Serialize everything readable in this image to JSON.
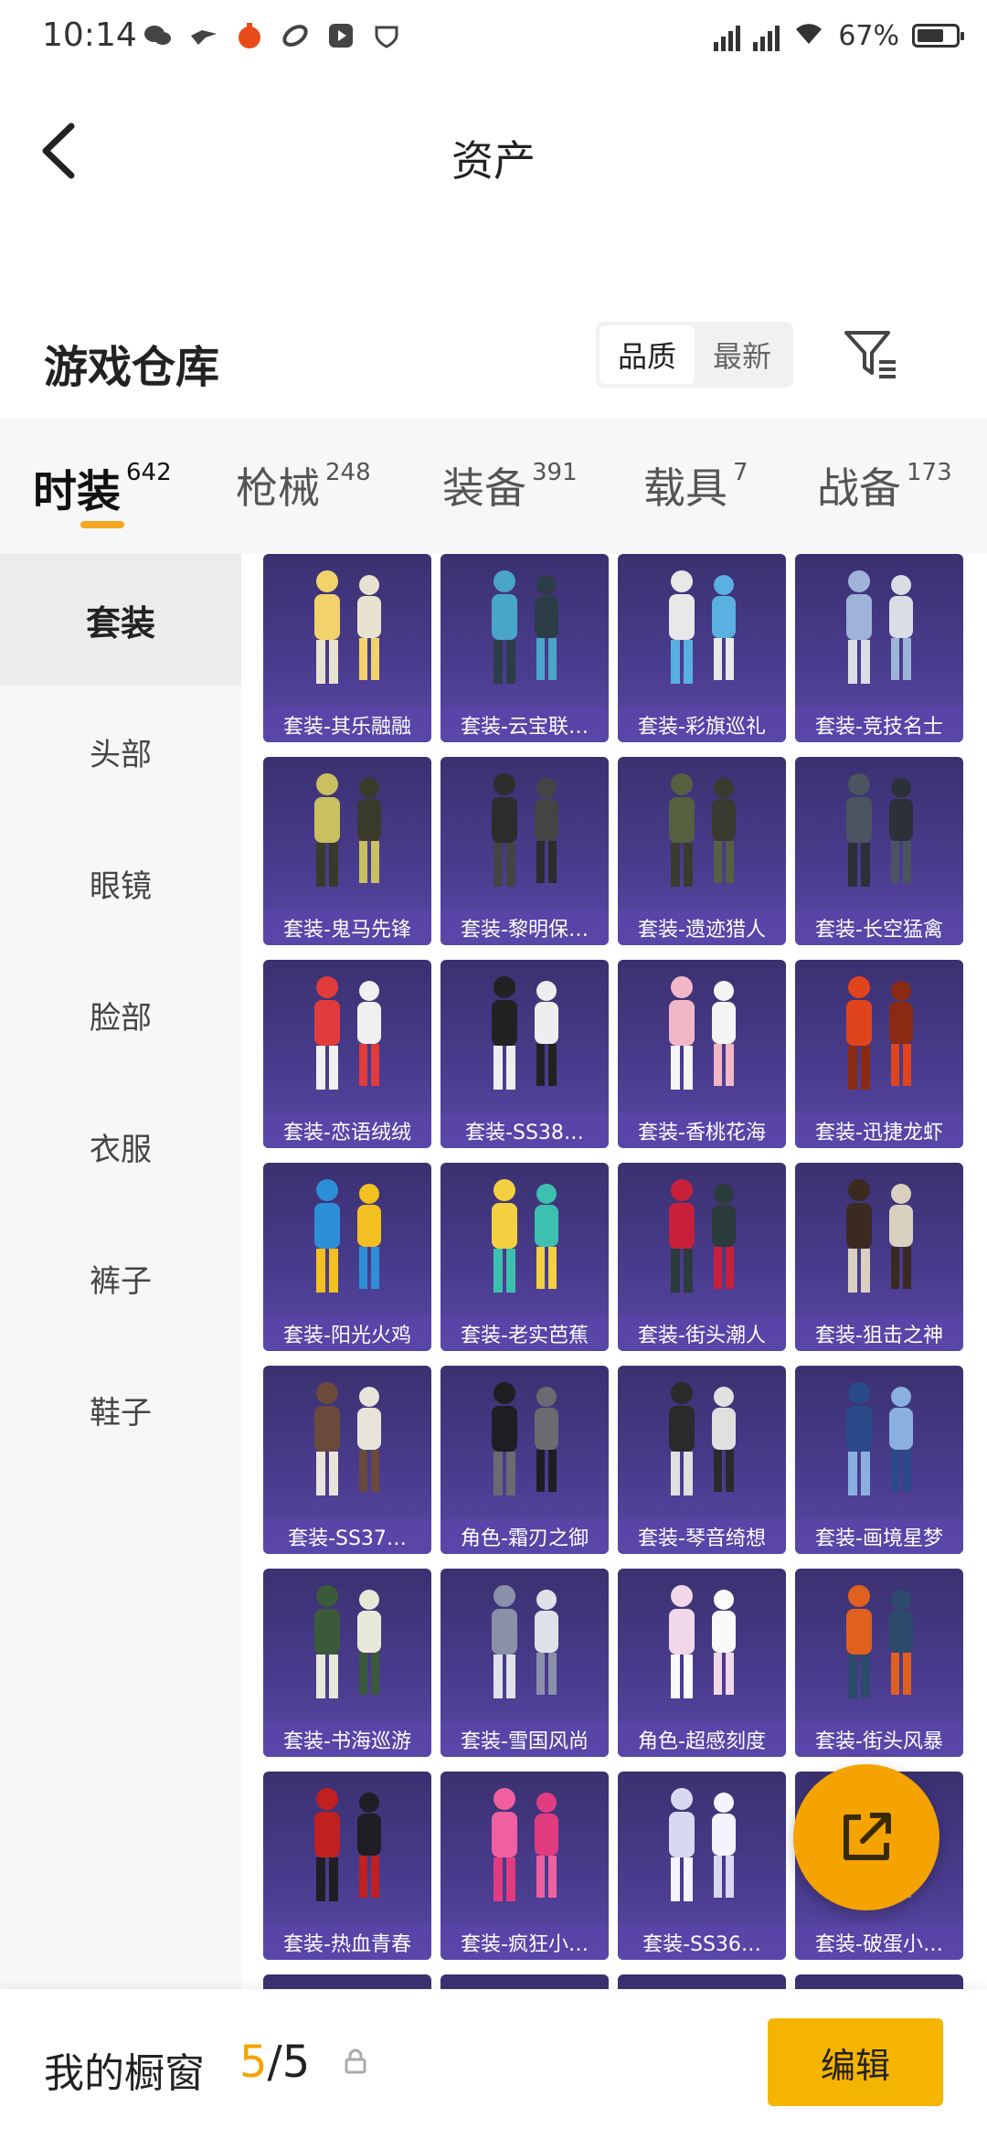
{
  "status_bar": {
    "time": "10:14",
    "network1": "4G+",
    "network2": "4G+",
    "battery": "67%"
  },
  "header": {
    "title": "资产"
  },
  "warehouse": {
    "title": "游戏仓库",
    "sort_options": [
      "品质",
      "最新"
    ],
    "active_sort": "品质"
  },
  "tabs": [
    {
      "name": "时装",
      "count": "642",
      "active": true
    },
    {
      "name": "枪械",
      "count": "248"
    },
    {
      "name": "装备",
      "count": "391"
    },
    {
      "name": "载具",
      "count": "7"
    },
    {
      "name": "战备",
      "count": "173"
    }
  ],
  "sidebar": {
    "items": [
      "套装",
      "头部",
      "眼镜",
      "脸部",
      "衣服",
      "裤子",
      "鞋子"
    ],
    "active": "套装"
  },
  "items": [
    "套装-其乐融融",
    "套装-云宝联…",
    "套装-彩旗巡礼",
    "套装-竞技名士",
    "套装-鬼马先锋",
    "套装-黎明保…",
    "套装-遗迹猎人",
    "套装-长空猛禽",
    "套装-恋语绒绒",
    "套装-SS38…",
    "套装-香桃花海",
    "套装-迅捷龙虾",
    "套装-阳光火鸡",
    "套装-老实芭蕉",
    "套装-街头潮人",
    "套装-狙击之神",
    "套装-SS37…",
    "角色-霜刃之御",
    "套装-琴音绮想",
    "套装-画境星梦",
    "套装-书海巡游",
    "套装-雪国风尚",
    "角色-超感刻度",
    "套装-街头风暴",
    "套装-热血青春",
    "套装-疯狂小…",
    "套装-SS36…",
    "套装-破蛋小…"
  ],
  "bottom": {
    "label": "我的橱窗",
    "count_current": "5",
    "count_sep_total": "/5",
    "edit_label": "编辑"
  },
  "colors": {
    "accent": "#f5a300",
    "card_bg": "#4a3c8e"
  }
}
